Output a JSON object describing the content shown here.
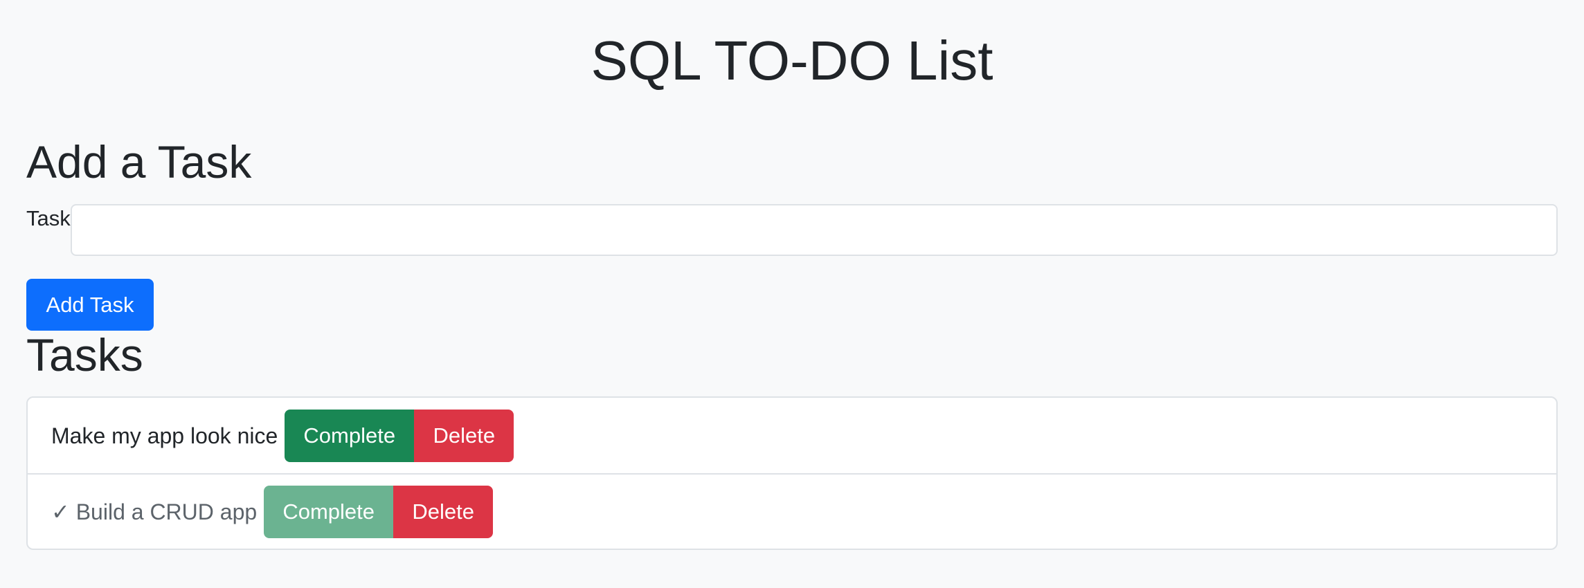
{
  "app": {
    "title": "SQL TO-DO List"
  },
  "add_section": {
    "heading": "Add a Task",
    "input_label": "Task",
    "input_value": "",
    "input_placeholder": "",
    "submit_label": "Add Task"
  },
  "tasks_section": {
    "heading": "Tasks",
    "items": [
      {
        "text": "Make my app look nice",
        "completed": false,
        "complete_label": "Complete",
        "delete_label": "Delete"
      },
      {
        "text": "✓ Build a CRUD app",
        "completed": true,
        "complete_label": "Complete",
        "delete_label": "Delete"
      }
    ]
  },
  "colors": {
    "background": "#f8f9fa",
    "primary": "#0d6efd",
    "success": "#198754",
    "success_disabled": "#6bb391",
    "danger": "#dc3545"
  }
}
